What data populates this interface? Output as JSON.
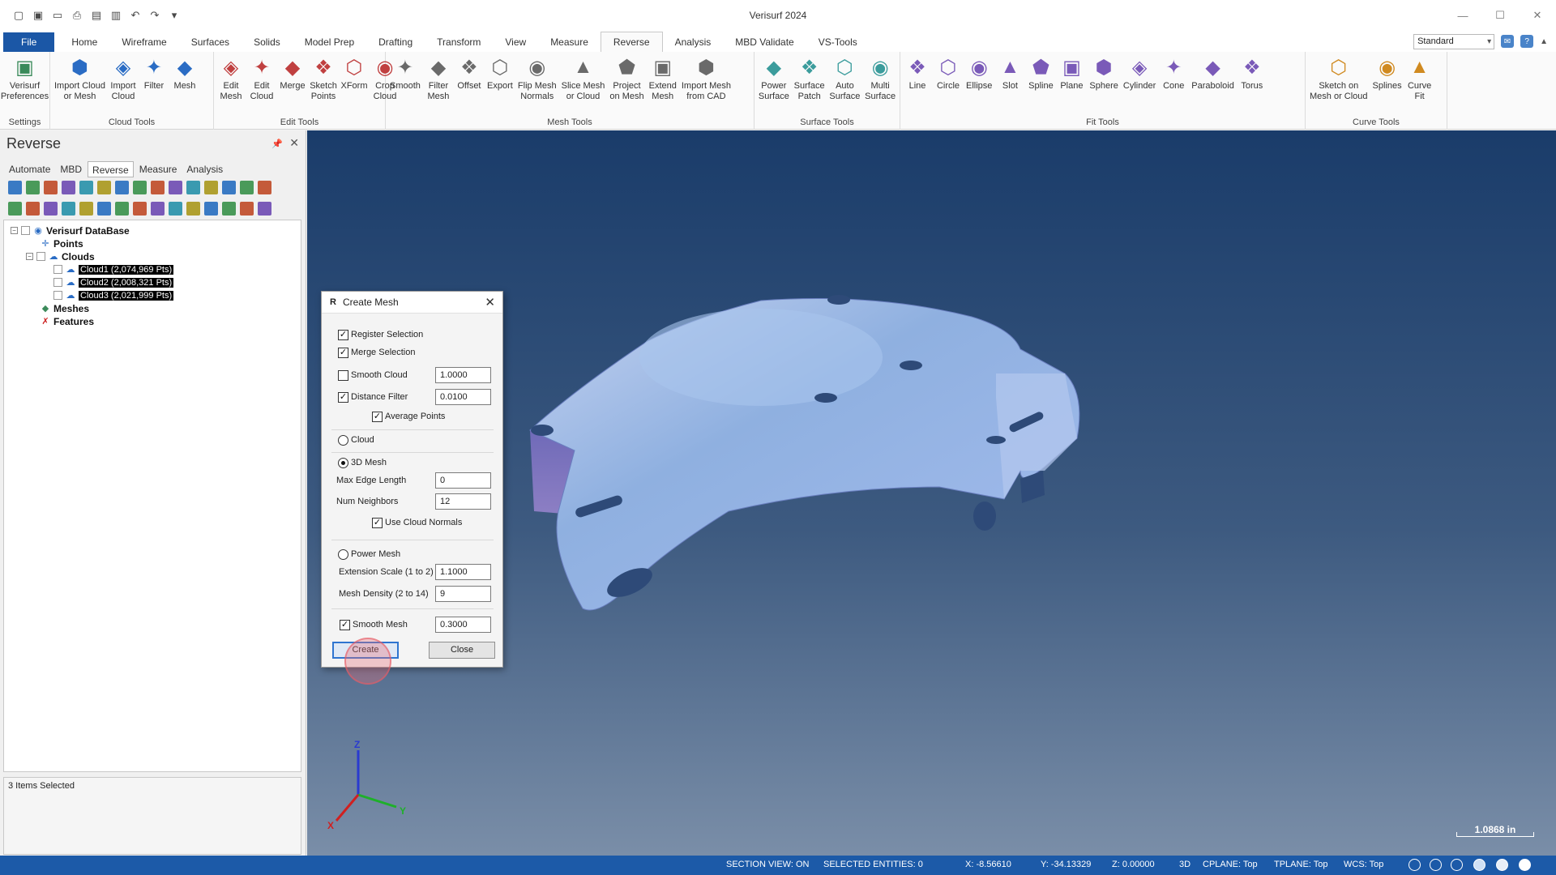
{
  "app": {
    "title": "Verisurf 2024"
  },
  "tabs": [
    "File",
    "Home",
    "Wireframe",
    "Surfaces",
    "Solids",
    "Model Prep",
    "Drafting",
    "Transform",
    "View",
    "Measure",
    "Reverse",
    "Analysis",
    "MBD Validate",
    "VS-Tools"
  ],
  "active_tab": "Reverse",
  "view_select": "Standard",
  "ribbon": [
    {
      "label": "Settings",
      "buttons": [
        "Verisurf\nPreferences"
      ]
    },
    {
      "label": "Cloud Tools",
      "buttons": [
        "Import Cloud\nor Mesh",
        "Import\nCloud",
        "Filter",
        "Mesh"
      ]
    },
    {
      "label": "Edit Tools",
      "buttons": [
        "Edit\nMesh",
        "Edit\nCloud",
        "Merge",
        "Sketch\nPoints",
        "XForm",
        "Crop\nCloud"
      ]
    },
    {
      "label": "Mesh Tools",
      "buttons": [
        "Smooth",
        "Filter\nMesh",
        "Offset",
        "Export",
        "Flip Mesh\nNormals",
        "Slice Mesh\nor Cloud",
        "Project\non Mesh",
        "Extend\nMesh",
        "Import Mesh\nfrom CAD"
      ]
    },
    {
      "label": "Surface Tools",
      "buttons": [
        "Power\nSurface",
        "Surface\nPatch",
        "Auto\nSurface",
        "Multi\nSurface"
      ]
    },
    {
      "label": "Fit Tools",
      "buttons": [
        "Line",
        "Circle",
        "Ellipse",
        "Slot",
        "Spline",
        "Plane",
        "Sphere",
        "Cylinder",
        "Cone",
        "Paraboloid",
        "Torus"
      ]
    },
    {
      "label": "Curve Tools",
      "buttons": [
        "Sketch on\nMesh or Cloud",
        "Splines",
        "Curve\nFit"
      ]
    }
  ],
  "panel": {
    "title": "Reverse",
    "tabs": [
      "Automate",
      "MBD",
      "Reverse",
      "Measure",
      "Analysis"
    ],
    "active_tab": "Reverse",
    "tree": {
      "root": "Verisurf DataBase",
      "points": "Points",
      "clouds": "Clouds",
      "cloud_items": [
        "Cloud1 (2,074,969 Pts)",
        "Cloud2 (2,008,321 Pts)",
        "Cloud3 (2,021,999 Pts)"
      ],
      "meshes": "Meshes",
      "features": "Features"
    },
    "status": "3 Items Selected"
  },
  "dialog": {
    "title": "Create Mesh",
    "register_selection": "Register Selection",
    "merge_selection": "Merge Selection",
    "smooth_cloud": "Smooth Cloud",
    "smooth_cloud_value": "1.0000",
    "distance_filter": "Distance Filter",
    "distance_filter_value": "0.0100",
    "average_points": "Average Points",
    "cloud": "Cloud",
    "mesh_3d": "3D Mesh",
    "max_edge_length": "Max Edge Length",
    "max_edge_length_value": "0",
    "num_neighbors": "Num Neighbors",
    "num_neighbors_value": "12",
    "use_cloud_normals": "Use Cloud Normals",
    "power_mesh": "Power Mesh",
    "extension_scale": "Extension Scale (1 to 2)",
    "extension_scale_value": "1.1000",
    "mesh_density": "Mesh Density (2 to 14)",
    "mesh_density_value": "9",
    "smooth_mesh": "Smooth Mesh",
    "smooth_mesh_value": "0.3000",
    "create": "Create",
    "close": "Close"
  },
  "viewport": {
    "axis_z": "Z",
    "axis_y": "Y",
    "axis_x": "X",
    "scale": "1.0868 in"
  },
  "statusbar": {
    "section_view": "SECTION VIEW: ON",
    "selected": "SELECTED ENTITIES: 0",
    "x": "X:  -8.56610",
    "y": "Y:  -34.13329",
    "z": "Z:  0.00000",
    "mode": "3D",
    "cplane": "CPLANE: Top",
    "tplane": "TPLANE: Top",
    "wcs": "WCS: Top"
  },
  "colors": {
    "accent": "#1c5aa8",
    "file_tab": "#1b57a6",
    "mesh": "#8fb0e0"
  }
}
